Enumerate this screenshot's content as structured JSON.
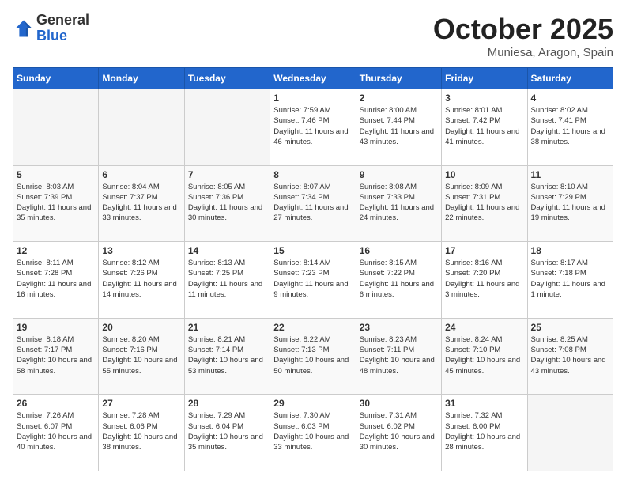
{
  "logo": {
    "general": "General",
    "blue": "Blue"
  },
  "header": {
    "month": "October 2025",
    "location": "Muniesa, Aragon, Spain"
  },
  "weekdays": [
    "Sunday",
    "Monday",
    "Tuesday",
    "Wednesday",
    "Thursday",
    "Friday",
    "Saturday"
  ],
  "weeks": [
    [
      {
        "day": "",
        "sunrise": "",
        "sunset": "",
        "daylight": ""
      },
      {
        "day": "",
        "sunrise": "",
        "sunset": "",
        "daylight": ""
      },
      {
        "day": "",
        "sunrise": "",
        "sunset": "",
        "daylight": ""
      },
      {
        "day": "1",
        "sunrise": "Sunrise: 7:59 AM",
        "sunset": "Sunset: 7:46 PM",
        "daylight": "Daylight: 11 hours and 46 minutes."
      },
      {
        "day": "2",
        "sunrise": "Sunrise: 8:00 AM",
        "sunset": "Sunset: 7:44 PM",
        "daylight": "Daylight: 11 hours and 43 minutes."
      },
      {
        "day": "3",
        "sunrise": "Sunrise: 8:01 AM",
        "sunset": "Sunset: 7:42 PM",
        "daylight": "Daylight: 11 hours and 41 minutes."
      },
      {
        "day": "4",
        "sunrise": "Sunrise: 8:02 AM",
        "sunset": "Sunset: 7:41 PM",
        "daylight": "Daylight: 11 hours and 38 minutes."
      }
    ],
    [
      {
        "day": "5",
        "sunrise": "Sunrise: 8:03 AM",
        "sunset": "Sunset: 7:39 PM",
        "daylight": "Daylight: 11 hours and 35 minutes."
      },
      {
        "day": "6",
        "sunrise": "Sunrise: 8:04 AM",
        "sunset": "Sunset: 7:37 PM",
        "daylight": "Daylight: 11 hours and 33 minutes."
      },
      {
        "day": "7",
        "sunrise": "Sunrise: 8:05 AM",
        "sunset": "Sunset: 7:36 PM",
        "daylight": "Daylight: 11 hours and 30 minutes."
      },
      {
        "day": "8",
        "sunrise": "Sunrise: 8:07 AM",
        "sunset": "Sunset: 7:34 PM",
        "daylight": "Daylight: 11 hours and 27 minutes."
      },
      {
        "day": "9",
        "sunrise": "Sunrise: 8:08 AM",
        "sunset": "Sunset: 7:33 PM",
        "daylight": "Daylight: 11 hours and 24 minutes."
      },
      {
        "day": "10",
        "sunrise": "Sunrise: 8:09 AM",
        "sunset": "Sunset: 7:31 PM",
        "daylight": "Daylight: 11 hours and 22 minutes."
      },
      {
        "day": "11",
        "sunrise": "Sunrise: 8:10 AM",
        "sunset": "Sunset: 7:29 PM",
        "daylight": "Daylight: 11 hours and 19 minutes."
      }
    ],
    [
      {
        "day": "12",
        "sunrise": "Sunrise: 8:11 AM",
        "sunset": "Sunset: 7:28 PM",
        "daylight": "Daylight: 11 hours and 16 minutes."
      },
      {
        "day": "13",
        "sunrise": "Sunrise: 8:12 AM",
        "sunset": "Sunset: 7:26 PM",
        "daylight": "Daylight: 11 hours and 14 minutes."
      },
      {
        "day": "14",
        "sunrise": "Sunrise: 8:13 AM",
        "sunset": "Sunset: 7:25 PM",
        "daylight": "Daylight: 11 hours and 11 minutes."
      },
      {
        "day": "15",
        "sunrise": "Sunrise: 8:14 AM",
        "sunset": "Sunset: 7:23 PM",
        "daylight": "Daylight: 11 hours and 9 minutes."
      },
      {
        "day": "16",
        "sunrise": "Sunrise: 8:15 AM",
        "sunset": "Sunset: 7:22 PM",
        "daylight": "Daylight: 11 hours and 6 minutes."
      },
      {
        "day": "17",
        "sunrise": "Sunrise: 8:16 AM",
        "sunset": "Sunset: 7:20 PM",
        "daylight": "Daylight: 11 hours and 3 minutes."
      },
      {
        "day": "18",
        "sunrise": "Sunrise: 8:17 AM",
        "sunset": "Sunset: 7:18 PM",
        "daylight": "Daylight: 11 hours and 1 minute."
      }
    ],
    [
      {
        "day": "19",
        "sunrise": "Sunrise: 8:18 AM",
        "sunset": "Sunset: 7:17 PM",
        "daylight": "Daylight: 10 hours and 58 minutes."
      },
      {
        "day": "20",
        "sunrise": "Sunrise: 8:20 AM",
        "sunset": "Sunset: 7:16 PM",
        "daylight": "Daylight: 10 hours and 55 minutes."
      },
      {
        "day": "21",
        "sunrise": "Sunrise: 8:21 AM",
        "sunset": "Sunset: 7:14 PM",
        "daylight": "Daylight: 10 hours and 53 minutes."
      },
      {
        "day": "22",
        "sunrise": "Sunrise: 8:22 AM",
        "sunset": "Sunset: 7:13 PM",
        "daylight": "Daylight: 10 hours and 50 minutes."
      },
      {
        "day": "23",
        "sunrise": "Sunrise: 8:23 AM",
        "sunset": "Sunset: 7:11 PM",
        "daylight": "Daylight: 10 hours and 48 minutes."
      },
      {
        "day": "24",
        "sunrise": "Sunrise: 8:24 AM",
        "sunset": "Sunset: 7:10 PM",
        "daylight": "Daylight: 10 hours and 45 minutes."
      },
      {
        "day": "25",
        "sunrise": "Sunrise: 8:25 AM",
        "sunset": "Sunset: 7:08 PM",
        "daylight": "Daylight: 10 hours and 43 minutes."
      }
    ],
    [
      {
        "day": "26",
        "sunrise": "Sunrise: 7:26 AM",
        "sunset": "Sunset: 6:07 PM",
        "daylight": "Daylight: 10 hours and 40 minutes."
      },
      {
        "day": "27",
        "sunrise": "Sunrise: 7:28 AM",
        "sunset": "Sunset: 6:06 PM",
        "daylight": "Daylight: 10 hours and 38 minutes."
      },
      {
        "day": "28",
        "sunrise": "Sunrise: 7:29 AM",
        "sunset": "Sunset: 6:04 PM",
        "daylight": "Daylight: 10 hours and 35 minutes."
      },
      {
        "day": "29",
        "sunrise": "Sunrise: 7:30 AM",
        "sunset": "Sunset: 6:03 PM",
        "daylight": "Daylight: 10 hours and 33 minutes."
      },
      {
        "day": "30",
        "sunrise": "Sunrise: 7:31 AM",
        "sunset": "Sunset: 6:02 PM",
        "daylight": "Daylight: 10 hours and 30 minutes."
      },
      {
        "day": "31",
        "sunrise": "Sunrise: 7:32 AM",
        "sunset": "Sunset: 6:00 PM",
        "daylight": "Daylight: 10 hours and 28 minutes."
      },
      {
        "day": "",
        "sunrise": "",
        "sunset": "",
        "daylight": ""
      }
    ]
  ]
}
